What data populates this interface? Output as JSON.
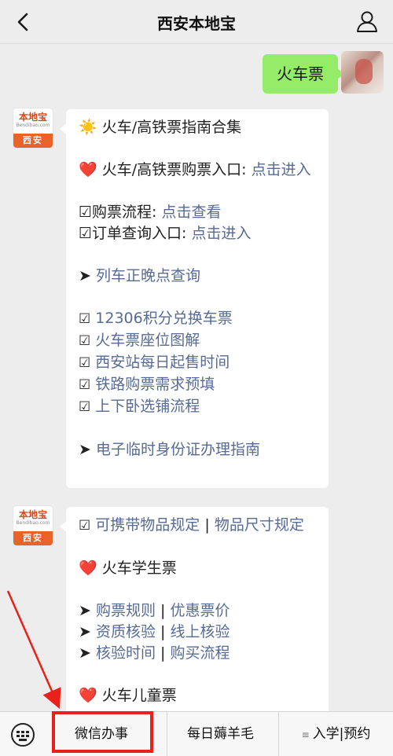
{
  "header": {
    "title": "西安本地宝",
    "back_icon": "back-icon",
    "profile_icon": "profile-icon"
  },
  "user_message": {
    "text": "火车票"
  },
  "bot": {
    "logo_main": "本地宝",
    "logo_sub": "Bendibao.com",
    "logo_city": "西安"
  },
  "message1": {
    "title_emoji": "☀️",
    "title": "火车/高铁票指南合集",
    "heart": "❤️",
    "ticket_entry_label": "火车/高铁票购票入口:",
    "ticket_entry_link": "点击进入",
    "process_label": "☑购票流程:",
    "process_link": "点击查看",
    "order_label": "☑订单查询入口:",
    "order_link": "点击进入",
    "arrow": "➤",
    "punctual_link": "列车正晚点查询",
    "check_items": [
      "12306积分兑换车票",
      "火车票座位图解",
      "西安站每日起售时间",
      "铁路购票需求预填",
      "上下卧选铺流程"
    ],
    "check_mark": "☑",
    "id_arrow": "➤",
    "id_link": "电子临时身份证办理指南"
  },
  "message2": {
    "check_mark": "☑",
    "items_link1": "可携带物品规定",
    "sep": "|",
    "items_link2": "物品尺寸规定",
    "heart": "❤️",
    "student_title": "火车学生票",
    "arrow": "➤",
    "rows": [
      {
        "a": "购票规则",
        "b": "优惠票价"
      },
      {
        "a": "资质核验",
        "b": "线上核验"
      },
      {
        "a": "核验时间",
        "b": "购买流程"
      }
    ],
    "partial": "❤️ 火车儿童票"
  },
  "bottom_menu": {
    "keyboard_icon": "keyboard-icon",
    "item1": "微信办事",
    "item2": "每日薅羊毛",
    "item3_icon": "≡",
    "item3": "入学|预约"
  },
  "colors": {
    "link": "#576b95",
    "bubble_green": "#95ec69",
    "highlight_red": "#e8221a"
  }
}
